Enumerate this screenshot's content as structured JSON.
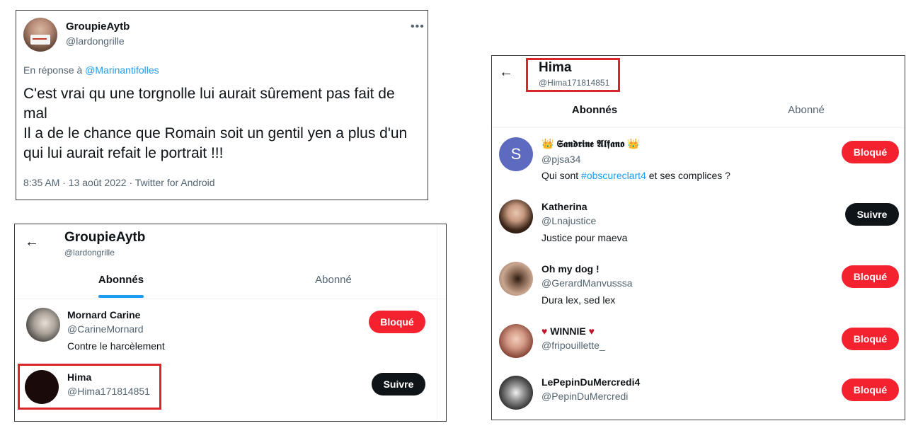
{
  "tweet": {
    "name": "GroupieAytb",
    "handle": "@lardongrille",
    "more_icon": "more-icon",
    "reply_prefix": "En réponse à ",
    "reply_to": "@Marinantifolles",
    "text": "C'est vrai qu une torgnolle lui aurait sûrement pas fait de mal\nIl a de le chance que Romain soit un gentil yen a plus d'un qui lui aurait refait le portrait !!!",
    "meta": "8:35 AM · 13 août 2022 · Twitter for Android"
  },
  "left_list": {
    "back_icon": "←",
    "header_name": "GroupieAytb",
    "header_handle": "@lardongrille",
    "tabs": [
      "Abonnés",
      "Abonné"
    ],
    "users": [
      {
        "name": "Mornard Carine",
        "handle": "@CarineMornard",
        "bio": "Contre le harcèlement",
        "button": "Bloqué"
      },
      {
        "name": "Hima",
        "handle": "@Hima171814851",
        "bio": "",
        "button": "Suivre"
      }
    ]
  },
  "right_list": {
    "back_icon": "←",
    "header_name": "Hima",
    "header_handle": "@Hima171814851",
    "tabs": [
      "Abonnés",
      "Abonné"
    ],
    "users": [
      {
        "name": "👑 𝕾𝖆𝖓𝖉𝖗𝖎𝖓𝖊 𝕬𝖑𝖋𝖆𝖓𝖔 👑",
        "handle": "@pjsa34",
        "bio_prefix": "Qui sont ",
        "bio_link": "#obscureclart4",
        "bio_suffix": " et ses complices ?",
        "button": "Bloqué",
        "avatar_letter": "S"
      },
      {
        "name": "Katherina",
        "handle": "@Lnajustice",
        "bio": "Justice pour maeva",
        "button": "Suivre"
      },
      {
        "name": "Oh my dog !",
        "handle": "@GerardManvusssa",
        "bio": "Dura lex, sed lex",
        "button": "Bloqué"
      },
      {
        "name": "♥ WINNIE ♥",
        "handle": "@fripouillette_",
        "bio": "",
        "button": "Bloqué"
      },
      {
        "name": "LePepinDuMercredi4",
        "handle": "@PepinDuMercredi",
        "bio": "",
        "button": "Bloqué"
      }
    ]
  },
  "colors": {
    "accent": "#1d9bf0",
    "blocked_button": "#f4212e",
    "follow_button": "#0f1419",
    "highlight_box": "#d9262b"
  }
}
